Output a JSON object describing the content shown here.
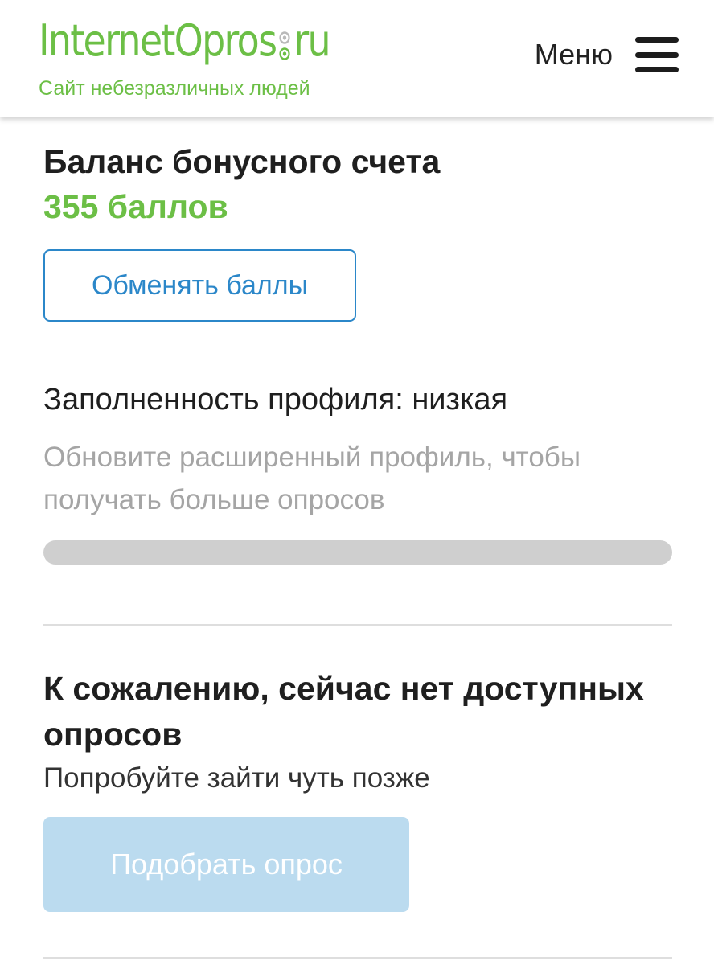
{
  "header": {
    "logo_part1": "InternetOpros",
    "logo_part2": "ru",
    "tagline": "Сайт небезразличных людей",
    "menu_label": "Меню"
  },
  "balance": {
    "title": "Баланс бонусного счета",
    "value": "355 баллов",
    "exchange_button": "Обменять баллы"
  },
  "profile": {
    "title": "Заполненность профиля: низкая",
    "hint": "Обновите расширенный профиль, чтобы получать больше опросов",
    "progress_percent": 0
  },
  "surveys": {
    "title": "К сожалению, сейчас нет доступных опросов",
    "subtitle": "Попробуйте зайти чуть позже",
    "pick_button": "Подобрать опрос",
    "pick_button_disabled": true
  },
  "colors": {
    "brand_green": "#6cbf46",
    "link_blue": "#2b87c9",
    "disabled_button": "#bbdbef",
    "progress_track": "#cfcfcf"
  }
}
